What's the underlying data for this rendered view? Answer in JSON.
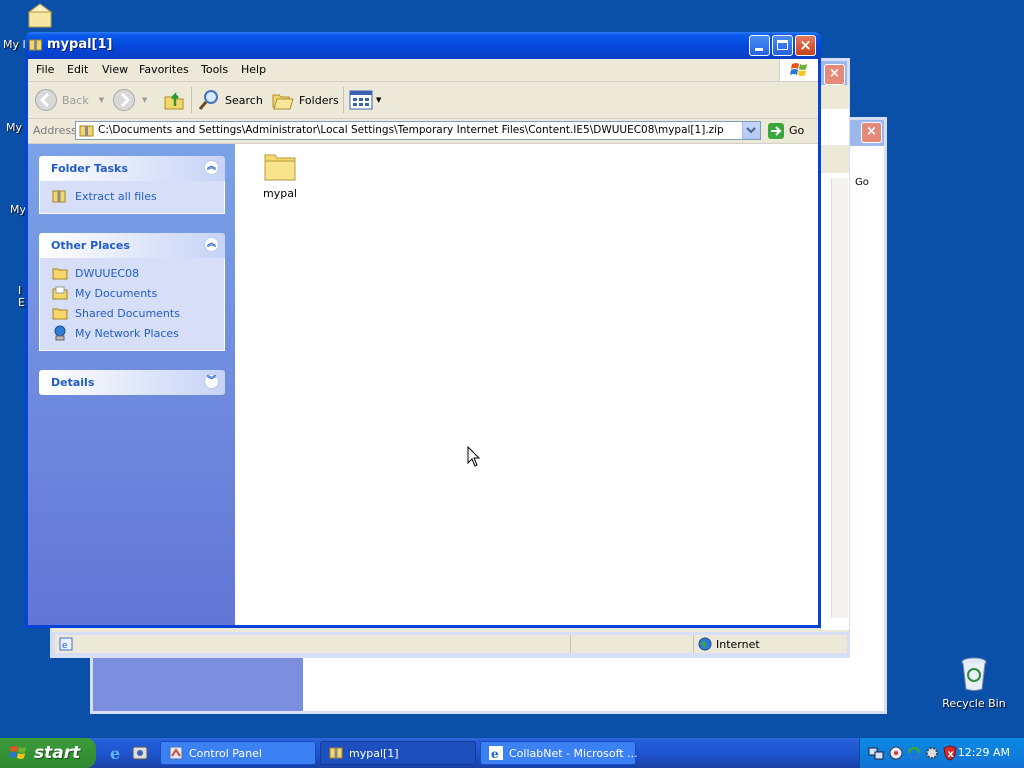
{
  "desktop": {
    "icons": [
      {
        "label": "My Documents",
        "partial": "My I"
      },
      {
        "label": "My Computer",
        "partial": "My"
      },
      {
        "label": "My Network Places",
        "partial": "My"
      },
      {
        "label": "Internet Explorer",
        "partial": "I\nE"
      }
    ],
    "recycle_bin": "Recycle Bin"
  },
  "window": {
    "title": "mypal[1]",
    "menu": [
      "File",
      "Edit",
      "View",
      "Favorites",
      "Tools",
      "Help"
    ],
    "toolbar": {
      "back": "Back",
      "search": "Search",
      "folders": "Folders"
    },
    "address_label": "Address",
    "address": "C:\\Documents and Settings\\Administrator\\Local Settings\\Temporary Internet Files\\Content.IE5\\DWUUEC08\\mypal[1].zip",
    "go": "Go"
  },
  "left_pane": {
    "folder_tasks": {
      "title": "Folder Tasks",
      "items": [
        "Extract all files"
      ]
    },
    "other_places": {
      "title": "Other Places",
      "items": [
        "DWUUEC08",
        "My Documents",
        "Shared Documents",
        "My Network Places"
      ]
    },
    "details": {
      "title": "Details"
    }
  },
  "content": {
    "files": [
      {
        "name": "mypal"
      }
    ]
  },
  "back_window": {
    "go": "Go",
    "zone": "Internet"
  },
  "taskbar": {
    "start": "start",
    "tasks": [
      "Control Panel",
      "mypal[1]",
      "CollabNet - Microsoft ..."
    ],
    "clock": "12:29 AM"
  }
}
